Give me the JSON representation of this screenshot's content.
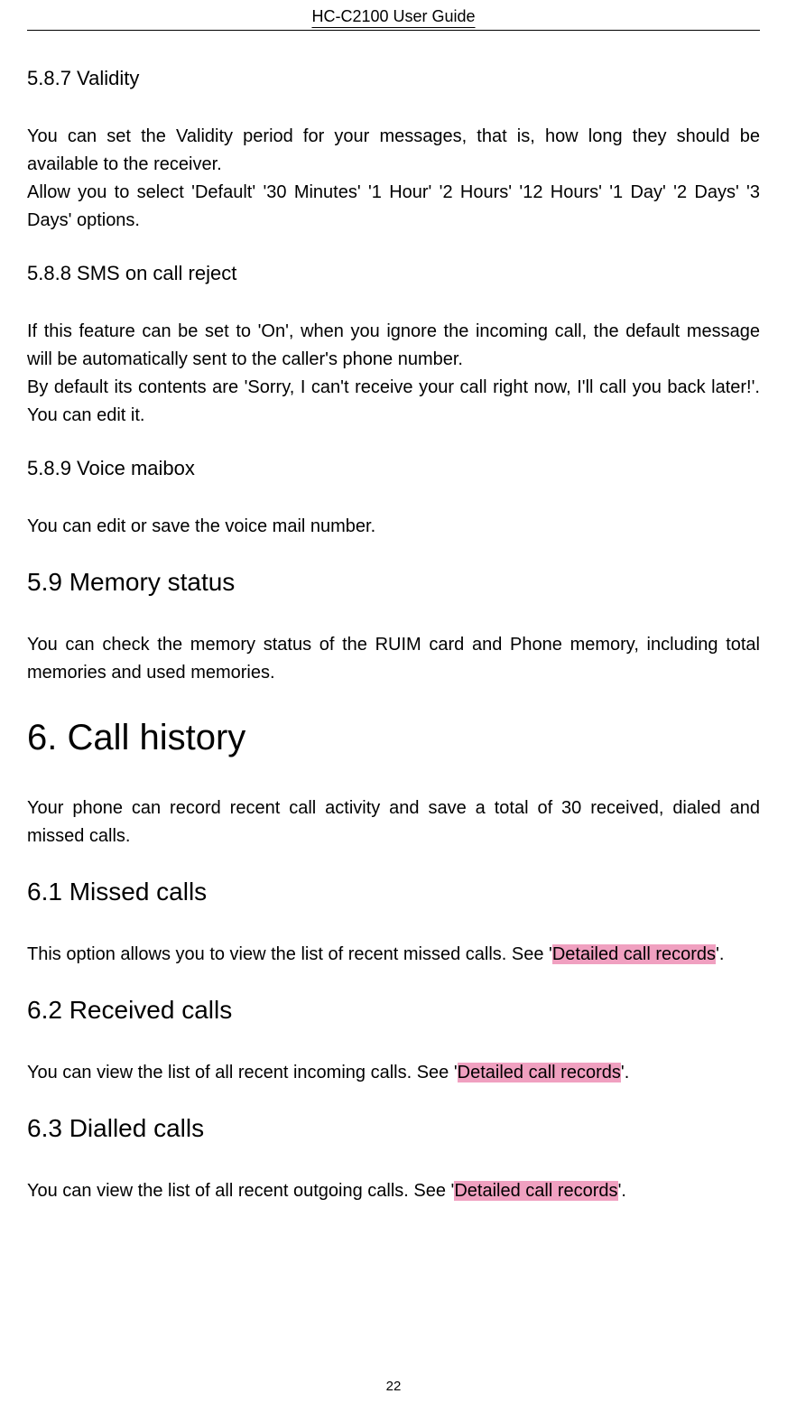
{
  "header": "HC-C2100 User Guide",
  "sections": {
    "s587": {
      "title": "5.8.7 Validity",
      "p1": "You can set the Validity period for your messages, that is, how long they should be available to the receiver.",
      "p2": "Allow you to select 'Default' '30 Minutes' '1 Hour' '2 Hours' '12 Hours' '1 Day' '2 Days' '3 Days' options."
    },
    "s588": {
      "title": "5.8.8 SMS on call reject",
      "p1": "If this feature can be set to 'On', when you ignore the incoming call, the default message will be automatically sent to the caller's phone number.",
      "p2": "By default its contents are 'Sorry, I can't receive your call right now, I'll call you back later!'. You can edit it."
    },
    "s589": {
      "title": "5.8.9 Voice maibox",
      "p1": "You can edit or save the voice mail number."
    },
    "s59": {
      "title": "5.9 Memory status",
      "p1": "You can check the memory status of the RUIM card and Phone memory, including total memories and used memories."
    },
    "s6": {
      "title": "6. Call history",
      "p1": "Your phone can record recent call activity and save a total of 30 received, dialed and missed calls."
    },
    "s61": {
      "title": "6.1 Missed calls",
      "p1a": "This option allows you to view the list of recent missed calls. See '",
      "p1_link": "Detailed call records",
      "p1b": "'."
    },
    "s62": {
      "title": "6.2 Received calls",
      "p1a": "You can view the list of all recent incoming calls. See '",
      "p1_link": "Detailed call records",
      "p1b": "'."
    },
    "s63": {
      "title": "6.3 Dialled calls",
      "p1a": "You can view the list of all recent outgoing calls. See '",
      "p1_link": "Detailed call records",
      "p1b": "'."
    }
  },
  "page_number": "22"
}
